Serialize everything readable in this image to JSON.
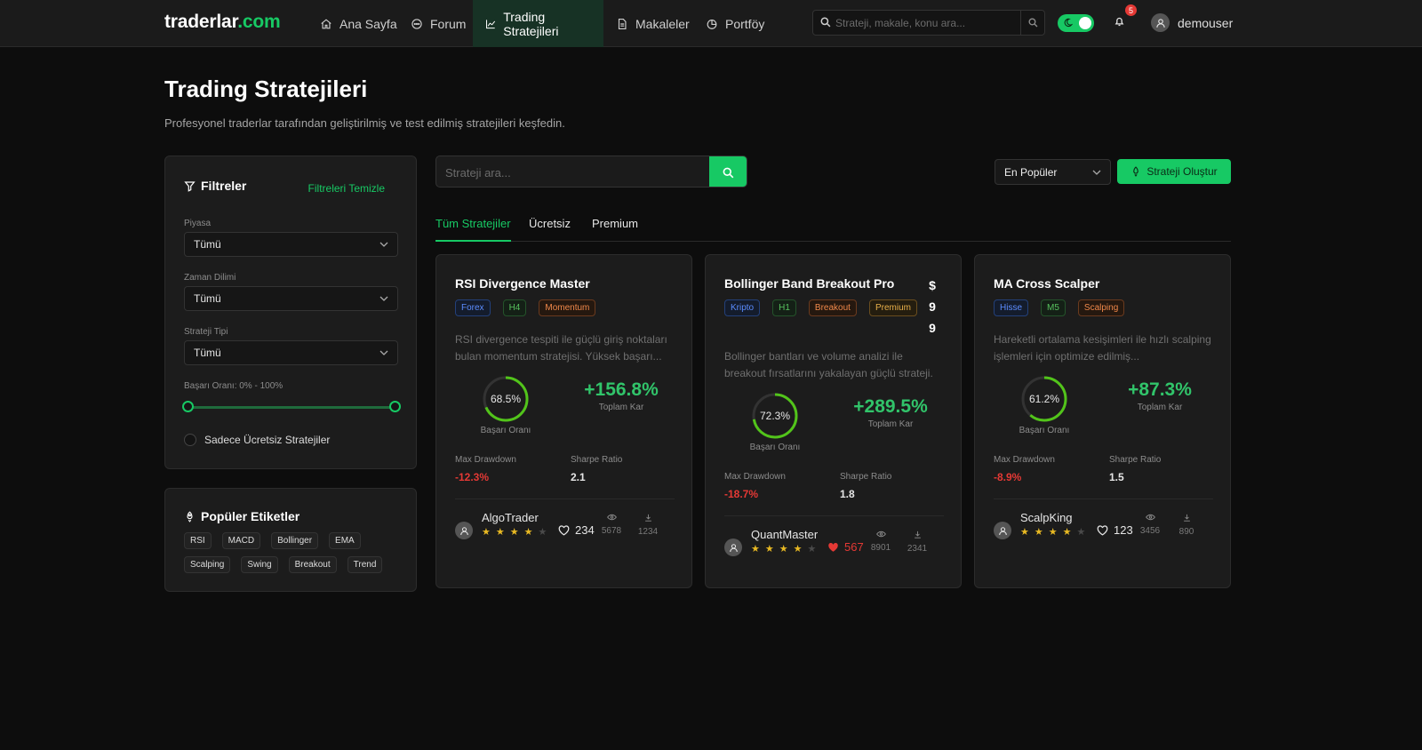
{
  "brand": {
    "name": "traderlar",
    "tld": ".com"
  },
  "nav": {
    "items": [
      {
        "label": "Ana Sayfa",
        "icon": "home-icon"
      },
      {
        "label": "Forum",
        "icon": "chat-icon"
      },
      {
        "label": "Trading Stratejileri",
        "icon": "chart-line-icon",
        "active": true
      },
      {
        "label": "Makaleler",
        "icon": "document-icon"
      },
      {
        "label": "Portföy",
        "icon": "pie-chart-icon"
      }
    ],
    "search_placeholder": "Strateji, makale, konu ara...",
    "notification_count": "5",
    "username": "demouser"
  },
  "page": {
    "title": "Trading Stratejileri",
    "subtitle": "Profesyonel traderlar tarafından geliştirilmiş ve test edilmiş stratejileri keşfedin."
  },
  "filters": {
    "title": "Filtreler",
    "clear_label": "Filtreleri Temizle",
    "market_label": "Piyasa",
    "market_value": "Tümü",
    "timeframe_label": "Zaman Dilimi",
    "timeframe_value": "Tümü",
    "type_label": "Strateji Tipi",
    "type_value": "Tümü",
    "success_label": "Başarı Oranı: 0% - 100%",
    "free_only_label": "Sadece Ücretsiz Stratejiler"
  },
  "popular_tags": {
    "title": "Popüler Etiketler",
    "tags": [
      "RSI",
      "MACD",
      "Bollinger",
      "EMA",
      "Scalping",
      "Swing",
      "Breakout",
      "Trend"
    ]
  },
  "toolbar": {
    "search_placeholder": "Strateji ara...",
    "sort_value": "En Popüler",
    "create_label": "Strateji Oluştur"
  },
  "tabs": [
    {
      "label": "Tüm Stratejiler",
      "active": true
    },
    {
      "label": "Ücretsiz"
    },
    {
      "label": "Premium"
    }
  ],
  "labels": {
    "success_rate": "Başarı Oranı",
    "total_profit": "Toplam Kar",
    "max_drawdown": "Max Drawdown",
    "sharpe_ratio": "Sharpe Ratio"
  },
  "strategies": [
    {
      "title": "RSI Divergence Master",
      "tags": [
        {
          "label": "Forex",
          "color": "blue"
        },
        {
          "label": "H4",
          "color": "green"
        },
        {
          "label": "Momentum",
          "color": "orange"
        }
      ],
      "description": "RSI divergence tespiti ile güçlü giriş noktaları bulan momentum stratejisi. Yüksek başarı...",
      "success_rate_text": "68.5%",
      "success_rate": 0.685,
      "total_profit": "+156.8%",
      "max_drawdown": "-12.3%",
      "sharpe_ratio": "2.1",
      "author": "AlgoTrader",
      "rating": 4,
      "likes": "234",
      "liked": false,
      "views": "5678",
      "downloads": "1234"
    },
    {
      "title": "Bollinger Band Breakout Pro",
      "tags": [
        {
          "label": "Kripto",
          "color": "blue"
        },
        {
          "label": "H1",
          "color": "green"
        },
        {
          "label": "Breakout",
          "color": "orange"
        },
        {
          "label": "Premium",
          "color": "yellow"
        }
      ],
      "price": [
        "$",
        "9",
        "9"
      ],
      "description": "Bollinger bantları ve volume analizi ile breakout fırsatlarını yakalayan güçlü strateji.",
      "success_rate_text": "72.3%",
      "success_rate": 0.723,
      "total_profit": "+289.5%",
      "max_drawdown": "-18.7%",
      "sharpe_ratio": "1.8",
      "author": "QuantMaster",
      "rating": 4,
      "likes": "567",
      "liked": true,
      "views": "8901",
      "downloads": "2341"
    },
    {
      "title": "MA Cross Scalper",
      "tags": [
        {
          "label": "Hisse",
          "color": "blue"
        },
        {
          "label": "M5",
          "color": "green"
        },
        {
          "label": "Scalping",
          "color": "orange"
        }
      ],
      "description": "Hareketli ortalama kesişimleri ile hızlı scalping işlemleri için optimize edilmiş...",
      "success_rate_text": "61.2%",
      "success_rate": 0.612,
      "total_profit": "+87.3%",
      "max_drawdown": "-8.9%",
      "sharpe_ratio": "1.5",
      "author": "ScalpKing",
      "rating": 4,
      "likes": "123",
      "liked": false,
      "views": "3456",
      "downloads": "890"
    }
  ],
  "colors": {
    "accent": "#17c964",
    "negative": "#e53935",
    "star": "#e8b923"
  }
}
